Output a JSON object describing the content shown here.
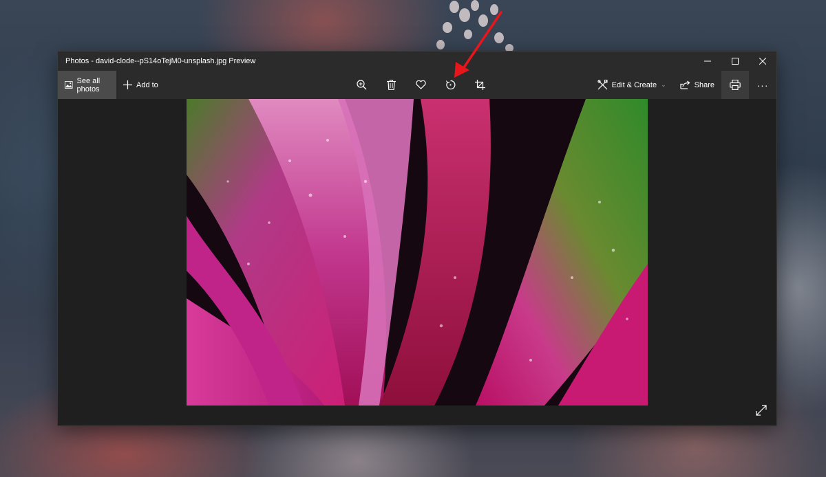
{
  "window": {
    "title": "Photos - david-clode--pS14oTejM0-unsplash.jpg Preview"
  },
  "toolbar": {
    "see_all_label": "See all photos",
    "add_to_label": "Add to",
    "edit_create_label": "Edit & Create",
    "share_label": "Share",
    "more_label": "···"
  },
  "icons": {
    "see_all": "gallery-icon",
    "add_to": "plus-icon",
    "zoom": "zoom-in-icon",
    "delete": "trash-icon",
    "favorite": "heart-icon",
    "rotate": "rotate-icon",
    "crop": "crop-icon",
    "edit_create": "edit-create-icon",
    "share": "share-icon",
    "print": "print-icon",
    "fullscreen": "expand-icon",
    "minimize": "minimize-icon",
    "maximize": "maximize-icon",
    "close": "close-icon"
  },
  "colors": {
    "titlebar": "#2b2b2b",
    "canvas": "#1f1f1f",
    "selected_tab": "#4b4b4b",
    "annotation_arrow": "#e8161b"
  }
}
